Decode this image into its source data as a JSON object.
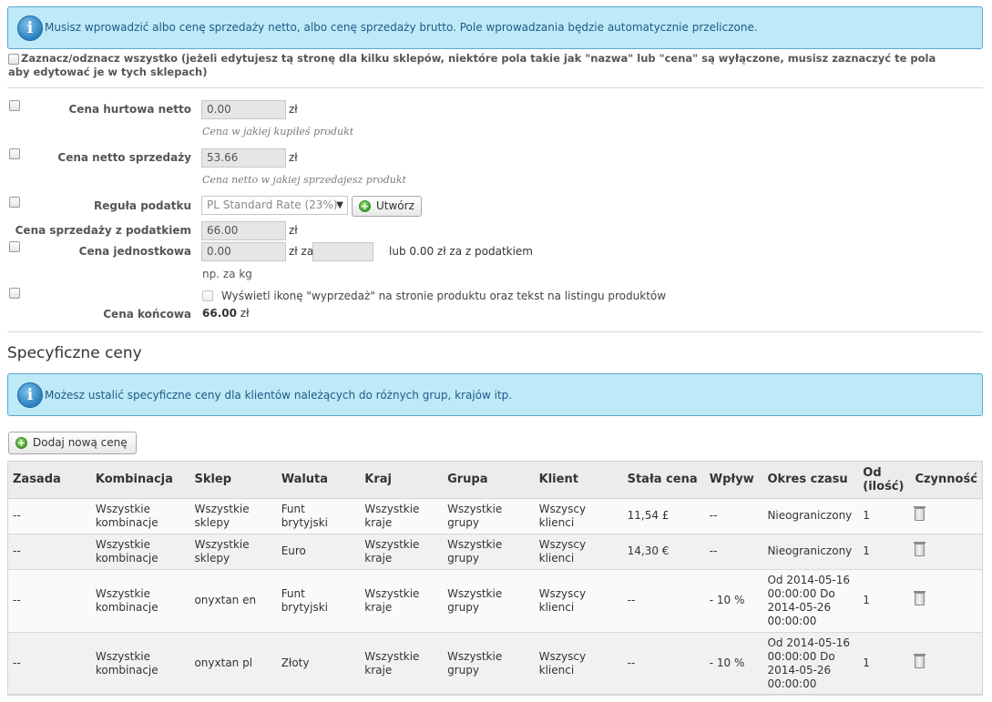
{
  "notice_top": "Musisz wprowadzić albo cenę sprzedaży netto, albo cenę sprzedaży brutto. Pole wprowadzania będzie automatycznie przeliczone.",
  "select_all": "Zaznacz/odznacz wszystko (jeżeli edytujesz tą stronę dla kilku sklepów, niektóre pola takie jak \"nazwa\" lub \"cena\" są wyłączone, musisz zaznaczyć te pola aby edytować je w tych sklepach)",
  "wholesale": {
    "label": "Cena hurtowa netto",
    "value": "0.00",
    "unit": "zł",
    "hint": "Cena w jakiej kupiłeś produkt"
  },
  "net_price": {
    "label": "Cena netto sprzedaży",
    "value": "53.66",
    "unit": "zł",
    "hint": "Cena netto w jakiej sprzedajesz produkt"
  },
  "tax_rule": {
    "label": "Reguła podatku",
    "selected": "PL Standard Rate (23%)",
    "create_button": "Utwórz"
  },
  "price_with_tax": {
    "label": "Cena sprzedaży z podatkiem",
    "value": "66.00",
    "unit": "zł"
  },
  "unit_price": {
    "label": "Cena jednostkowa",
    "value": "0.00",
    "unit": "zł za",
    "per_value": "",
    "with_tax_text": "lub 0.00 zł za z podatkiem",
    "hint": "np. za kg"
  },
  "sale_checkbox": "Wyświetl ikonę \"wyprzedaż\" na stronie produktu oraz tekst na listingu produktów",
  "final_price": {
    "label": "Cena końcowa",
    "value": "66.00",
    "unit": "zł"
  },
  "specific_title": "Specyficzne ceny",
  "notice_specific": "Możesz ustalić specyficzne ceny dla klientów należących do różnych grup, krajów itp.",
  "add_price_button": "Dodaj nową cenę",
  "table": {
    "headers": [
      "Zasada",
      "Kombinacja",
      "Sklep",
      "Waluta",
      "Kraj",
      "Grupa",
      "Klient",
      "Stała cena",
      "Wpływ",
      "Okres czasu",
      "Od (ilość)",
      "Czynność"
    ],
    "rows": [
      {
        "rule": "--",
        "combination": "Wszystkie kombinacje",
        "shop": "Wszystkie sklepy",
        "currency": "Funt brytyjski",
        "country": "Wszystkie kraje",
        "group": "Wszystkie grupy",
        "customer": "Wszyscy klienci",
        "fixed_price": "11,54 £",
        "impact": "--",
        "period": "Nieograniczony",
        "from_qty": "1"
      },
      {
        "rule": "--",
        "combination": "Wszystkie kombinacje",
        "shop": "Wszystkie sklepy",
        "currency": "Euro",
        "country": "Wszystkie kraje",
        "group": "Wszystkie grupy",
        "customer": "Wszyscy klienci",
        "fixed_price": "14,30 €",
        "impact": "--",
        "period": "Nieograniczony",
        "from_qty": "1"
      },
      {
        "rule": "--",
        "combination": "Wszystkie kombinacje",
        "shop": "onyxtan en",
        "currency": "Funt brytyjski",
        "country": "Wszystkie kraje",
        "group": "Wszystkie grupy",
        "customer": "Wszyscy klienci",
        "fixed_price": "--",
        "impact": "- 10 %",
        "period": "Od 2014-05-16 00:00:00 Do 2014-05-26 00:00:00",
        "from_qty": "1"
      },
      {
        "rule": "--",
        "combination": "Wszystkie kombinacje",
        "shop": "onyxtan pl",
        "currency": "Złoty",
        "country": "Wszystkie kraje",
        "group": "Wszystkie grupy",
        "customer": "Wszyscy klienci",
        "fixed_price": "--",
        "impact": "- 10 %",
        "period": "Od 2014-05-16 00:00:00 Do 2014-05-26 00:00:00",
        "from_qty": "1"
      }
    ]
  }
}
